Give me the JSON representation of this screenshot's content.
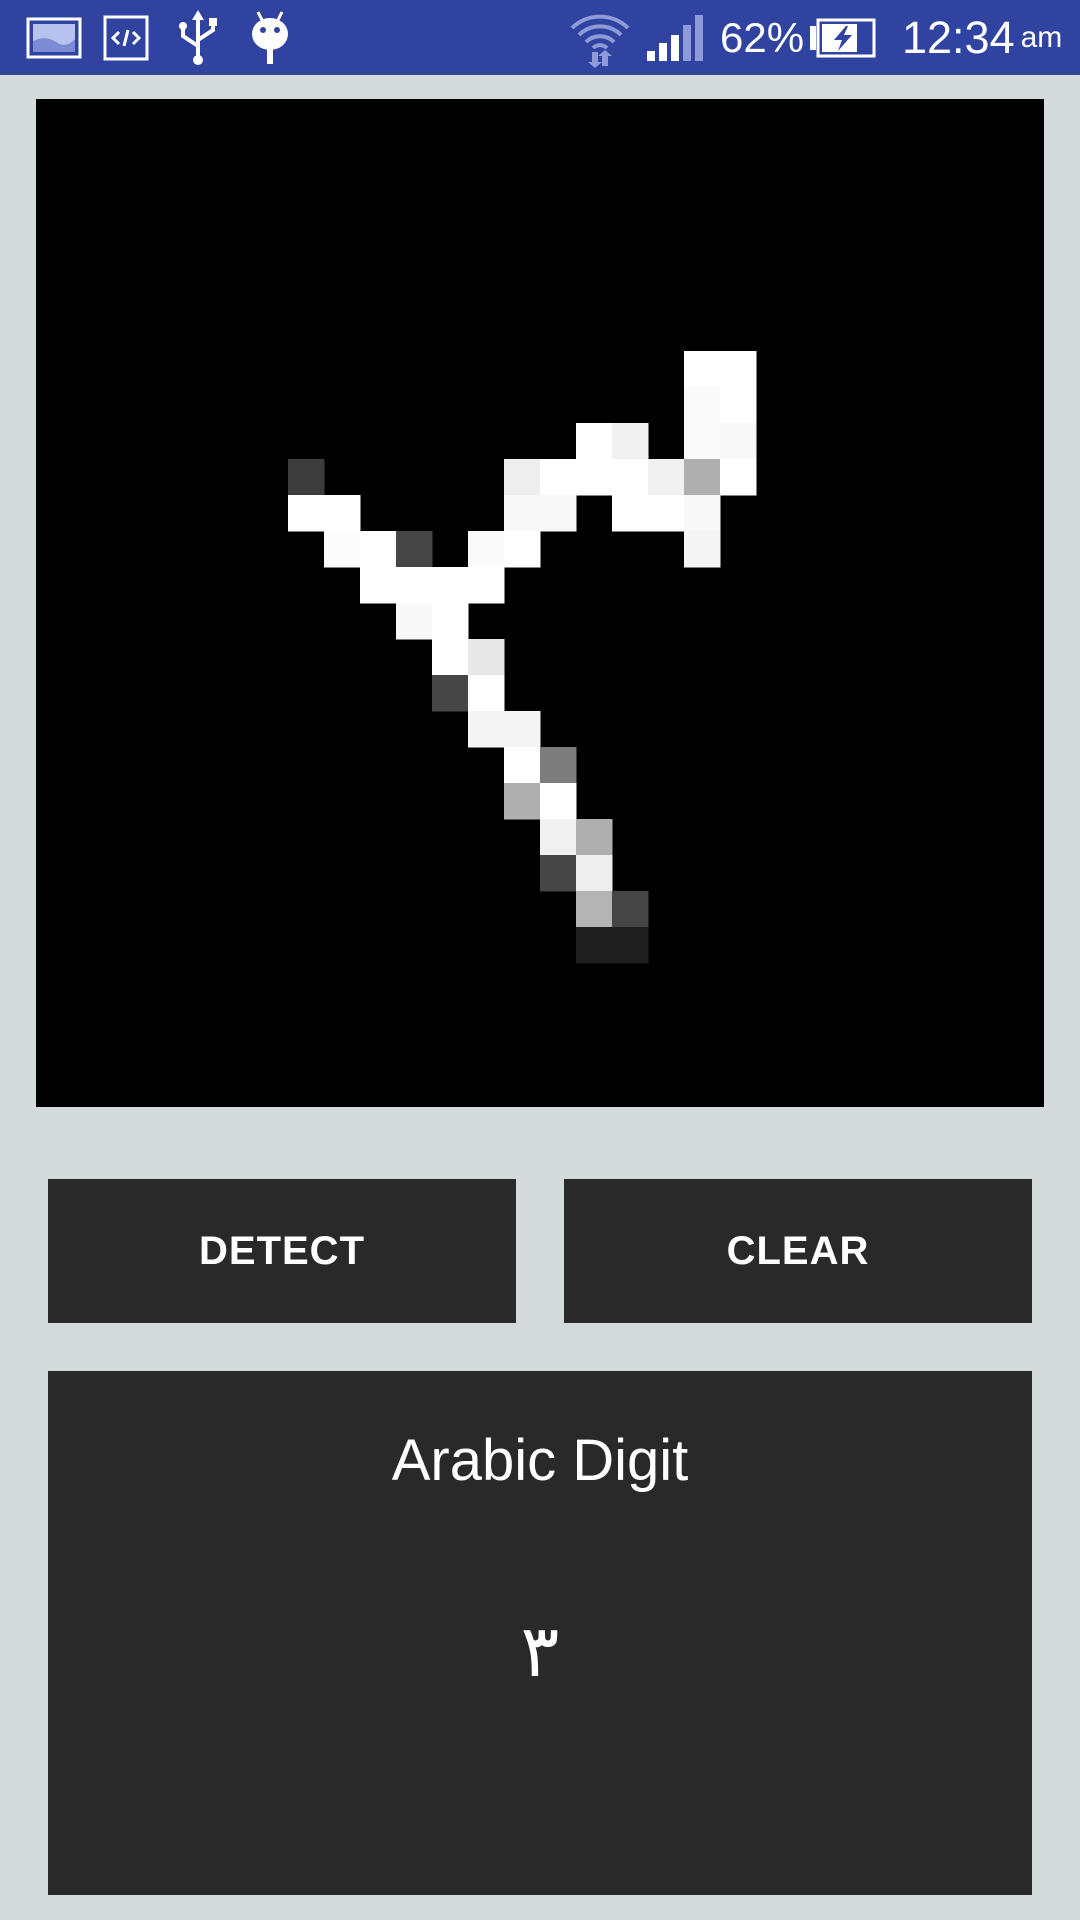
{
  "status_bar": {
    "background": "#3143a1",
    "left_icons": [
      "screenshot-icon",
      "code-icon",
      "usb-icon",
      "android-debug-icon"
    ],
    "right_icons": [
      "wifi-icon",
      "signal-icon",
      "battery-charging-icon"
    ],
    "battery_percent": "62%",
    "time": "12:34",
    "ampm": "am"
  },
  "canvas": {
    "grid_size": 28,
    "background": "#000000",
    "pixels": [
      [
        7,
        18,
        255
      ],
      [
        7,
        19,
        255
      ],
      [
        8,
        18,
        250
      ],
      [
        8,
        19,
        255
      ],
      [
        9,
        15,
        255
      ],
      [
        9,
        16,
        240
      ],
      [
        9,
        18,
        250
      ],
      [
        9,
        19,
        248
      ],
      [
        10,
        7,
        60
      ],
      [
        10,
        13,
        238
      ],
      [
        10,
        14,
        255
      ],
      [
        10,
        15,
        255
      ],
      [
        10,
        16,
        255
      ],
      [
        10,
        17,
        240
      ],
      [
        10,
        18,
        175
      ],
      [
        10,
        19,
        255
      ],
      [
        11,
        7,
        255
      ],
      [
        11,
        8,
        255
      ],
      [
        11,
        13,
        248
      ],
      [
        11,
        14,
        248
      ],
      [
        11,
        16,
        255
      ],
      [
        11,
        17,
        255
      ],
      [
        11,
        18,
        248
      ],
      [
        12,
        8,
        252
      ],
      [
        12,
        9,
        255
      ],
      [
        12,
        10,
        70
      ],
      [
        12,
        12,
        250
      ],
      [
        12,
        13,
        255
      ],
      [
        12,
        18,
        245
      ],
      [
        13,
        9,
        255
      ],
      [
        13,
        10,
        255
      ],
      [
        13,
        11,
        255
      ],
      [
        13,
        12,
        255
      ],
      [
        14,
        10,
        248
      ],
      [
        14,
        11,
        255
      ],
      [
        15,
        11,
        255
      ],
      [
        15,
        12,
        232
      ],
      [
        16,
        11,
        70
      ],
      [
        16,
        12,
        255
      ],
      [
        17,
        12,
        245
      ],
      [
        17,
        13,
        245
      ],
      [
        18,
        13,
        255
      ],
      [
        18,
        14,
        125
      ],
      [
        19,
        13,
        175
      ],
      [
        19,
        14,
        255
      ],
      [
        20,
        14,
        240
      ],
      [
        20,
        15,
        175
      ],
      [
        21,
        14,
        70
      ],
      [
        21,
        15,
        238
      ],
      [
        22,
        15,
        180
      ],
      [
        22,
        16,
        70
      ],
      [
        23,
        15,
        30
      ],
      [
        23,
        16,
        30
      ]
    ]
  },
  "buttons": {
    "detect_label": "DETECT",
    "clear_label": "CLEAR"
  },
  "result": {
    "title": "Arabic Digit",
    "digit": "٣"
  }
}
